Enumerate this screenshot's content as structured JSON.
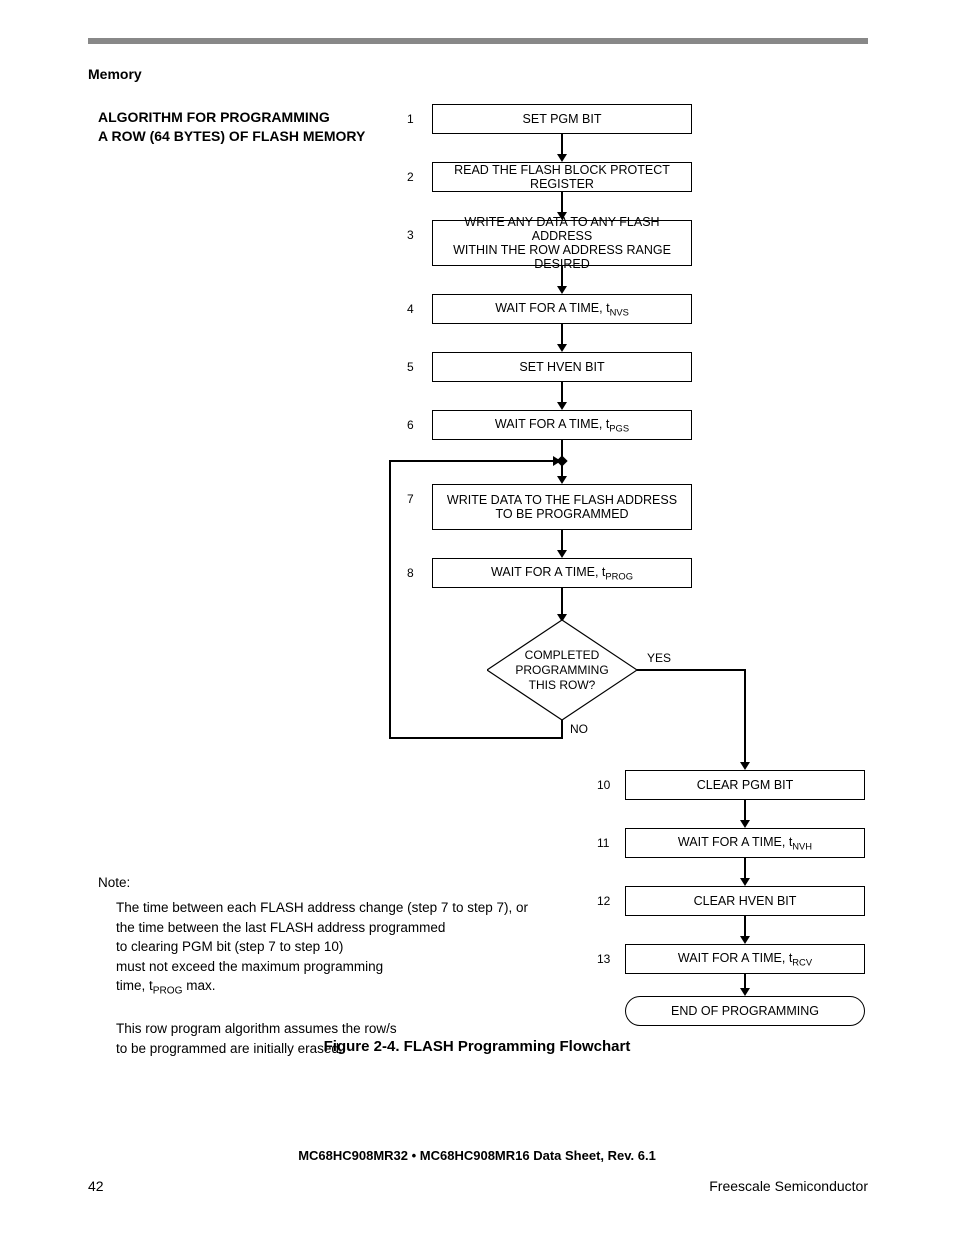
{
  "header": {
    "section": "Memory"
  },
  "title": {
    "line1": "ALGORITHM FOR PROGRAMMING",
    "line2": "A ROW (64 BYTES) OF FLASH MEMORY"
  },
  "steps": {
    "s1": {
      "num": "1",
      "text": "SET PGM BIT"
    },
    "s2": {
      "num": "2",
      "text": "READ THE FLASH BLOCK PROTECT REGISTER"
    },
    "s3": {
      "num": "3",
      "l1": "WRITE ANY DATA TO ANY FLASH ADDRESS",
      "l2": "WITHIN THE ROW ADDRESS RANGE DESIRED"
    },
    "s4": {
      "num": "4",
      "prefix": "WAIT FOR A TIME, t",
      "sub": "NVS"
    },
    "s5": {
      "num": "5",
      "text": "SET HVEN BIT"
    },
    "s6": {
      "num": "6",
      "prefix": "WAIT FOR A TIME, t",
      "sub": "PGS"
    },
    "s7": {
      "num": "7",
      "l1": "WRITE DATA TO THE FLASH ADDRESS",
      "l2": "TO BE PROGRAMMED"
    },
    "s8": {
      "num": "8",
      "prefix": "WAIT FOR A TIME, t",
      "sub": "PROG"
    },
    "s10": {
      "num": "10",
      "text": "CLEAR PGM BIT"
    },
    "s11": {
      "num": "11",
      "prefix": "WAIT FOR A TIME, t",
      "sub": "NVH"
    },
    "s12": {
      "num": "12",
      "text": "CLEAR HVEN BIT"
    },
    "s13": {
      "num": "13",
      "prefix": "WAIT FOR A TIME, t",
      "sub": "RCV"
    }
  },
  "decision": {
    "l1": "COMPLETED",
    "l2": "PROGRAMMING",
    "l3": "THIS ROW?"
  },
  "branches": {
    "yes": "YES",
    "no": "NO"
  },
  "terminator": "END OF PROGRAMMING",
  "note": {
    "label": "Note:",
    "l1": "The time between each FLASH address change (step 7 to step 7), or",
    "l2": "the time between the last FLASH address programmed",
    "l3": "to clearing PGM bit (step 7 to step 10)",
    "l4": "must not exceed the maximum programming",
    "l5a": "time, t",
    "l5sub": "PROG",
    "l5b": " max.",
    "l6": "This row program algorithm assumes the row/s",
    "l7": "to be programmed are initially erased."
  },
  "caption": "Figure 2-4. FLASH Programming Flowchart",
  "footer": {
    "center": "MC68HC908MR32 • MC68HC908MR16 Data Sheet, Rev. 6.1",
    "left": "42",
    "right": "Freescale Semiconductor"
  },
  "chart_data": {
    "type": "flowchart",
    "title": "FLASH Programming Flowchart",
    "nodes": [
      {
        "id": 1,
        "type": "process",
        "text": "SET PGM BIT"
      },
      {
        "id": 2,
        "type": "process",
        "text": "READ THE FLASH BLOCK PROTECT REGISTER"
      },
      {
        "id": 3,
        "type": "process",
        "text": "WRITE ANY DATA TO ANY FLASH ADDRESS WITHIN THE ROW ADDRESS RANGE DESIRED"
      },
      {
        "id": 4,
        "type": "process",
        "text": "WAIT FOR A TIME, t_NVS"
      },
      {
        "id": 5,
        "type": "process",
        "text": "SET HVEN BIT"
      },
      {
        "id": 6,
        "type": "process",
        "text": "WAIT FOR A TIME, t_PGS"
      },
      {
        "id": 7,
        "type": "process",
        "text": "WRITE DATA TO THE FLASH ADDRESS TO BE PROGRAMMED"
      },
      {
        "id": 8,
        "type": "process",
        "text": "WAIT FOR A TIME, t_PROG"
      },
      {
        "id": 9,
        "type": "decision",
        "text": "COMPLETED PROGRAMMING THIS ROW?"
      },
      {
        "id": 10,
        "type": "process",
        "text": "CLEAR PGM BIT"
      },
      {
        "id": 11,
        "type": "process",
        "text": "WAIT FOR A TIME, t_NVH"
      },
      {
        "id": 12,
        "type": "process",
        "text": "CLEAR HVEN BIT"
      },
      {
        "id": 13,
        "type": "process",
        "text": "WAIT FOR A TIME, t_RCV"
      },
      {
        "id": 14,
        "type": "terminator",
        "text": "END OF PROGRAMMING"
      }
    ],
    "edges": [
      {
        "from": 1,
        "to": 2
      },
      {
        "from": 2,
        "to": 3
      },
      {
        "from": 3,
        "to": 4
      },
      {
        "from": 4,
        "to": 5
      },
      {
        "from": 5,
        "to": 6
      },
      {
        "from": 6,
        "to": 7
      },
      {
        "from": 7,
        "to": 8
      },
      {
        "from": 8,
        "to": 9
      },
      {
        "from": 9,
        "to": 7,
        "label": "NO"
      },
      {
        "from": 9,
        "to": 10,
        "label": "YES"
      },
      {
        "from": 10,
        "to": 11
      },
      {
        "from": 11,
        "to": 12
      },
      {
        "from": 12,
        "to": 13
      },
      {
        "from": 13,
        "to": 14
      }
    ]
  }
}
